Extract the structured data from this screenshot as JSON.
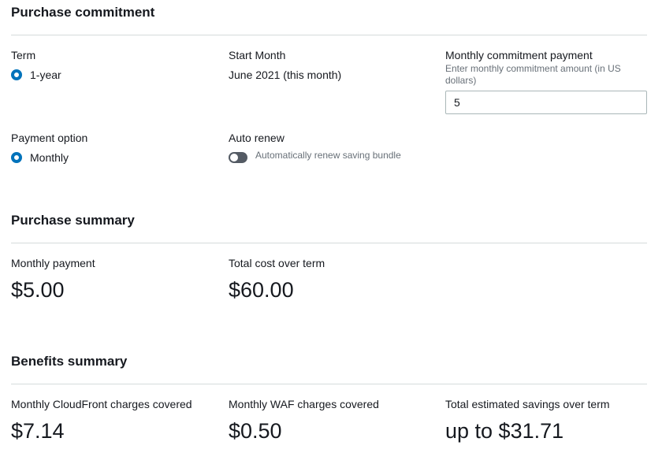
{
  "commitment": {
    "title": "Purchase commitment",
    "term_label": "Term",
    "term_option": "1-year",
    "start_label": "Start Month",
    "start_value": "June 2021 (this month)",
    "payment_label": "Monthly commitment payment",
    "payment_desc": "Enter monthly commitment amount (in US dollars)",
    "payment_value": "5",
    "option_label": "Payment option",
    "option_value": "Monthly",
    "renew_label": "Auto renew",
    "renew_desc": "Automatically renew saving bundle"
  },
  "summary": {
    "title": "Purchase summary",
    "monthly_label": "Monthly payment",
    "monthly_value": "$5.00",
    "total_label": "Total cost over term",
    "total_value": "$60.00"
  },
  "benefits": {
    "title": "Benefits summary",
    "cloudfront_label": "Monthly CloudFront charges covered",
    "cloudfront_value": "$7.14",
    "waf_label": "Monthly WAF charges covered",
    "waf_value": "$0.50",
    "savings_label": "Total estimated savings over term",
    "savings_value": "up to $31.71"
  },
  "colors": {
    "accent": "#0073bb",
    "divider": "#d5dbdb",
    "muted_text": "#687078",
    "toggle_off": "#545b64"
  }
}
